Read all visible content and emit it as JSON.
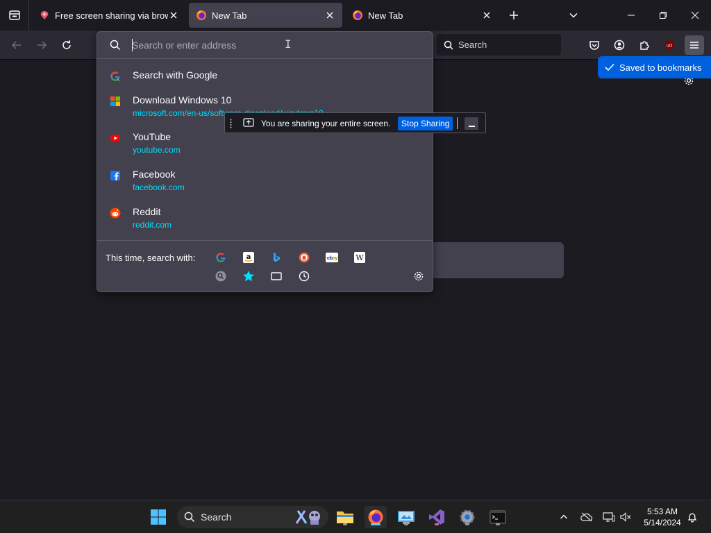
{
  "colors": {
    "toolbar": "#2b2a33",
    "panel": "#42414d",
    "accent": "#0061e0",
    "url": "#00ddff"
  },
  "tabs": [
    {
      "title": "Free screen sharing via browser",
      "icon": "screen-share-favicon",
      "active": false
    },
    {
      "title": "New Tab",
      "icon": "firefox-icon",
      "active": true
    },
    {
      "title": "New Tab",
      "icon": "firefox-icon",
      "active": false
    }
  ],
  "navbar": {
    "search_placeholder": "Search"
  },
  "urlbar": {
    "placeholder": "Search or enter address",
    "results": [
      {
        "title": "Search with Google",
        "url": "",
        "icon": "google-icon"
      },
      {
        "title": "Download Windows 10",
        "url": "microsoft.com/en-us/software-download/windows10",
        "icon": "microsoft-icon"
      },
      {
        "title": "YouTube",
        "url": "youtube.com",
        "icon": "youtube-icon"
      },
      {
        "title": "Facebook",
        "url": "facebook.com",
        "icon": "facebook-icon"
      },
      {
        "title": "Reddit",
        "url": "reddit.com",
        "icon": "reddit-icon"
      }
    ],
    "one_off_label": "This time, search with:",
    "engines": [
      "google-icon",
      "amazon-icon",
      "bing-icon",
      "duckduckgo-icon",
      "ebay-icon",
      "wikipedia-icon"
    ],
    "modes": [
      "search-tabs-icon",
      "bookmarks-star-icon",
      "tabs-icon",
      "history-clock-icon"
    ]
  },
  "sharing_bar": {
    "message": "You are sharing your entire screen.",
    "stop_label": "Stop Sharing"
  },
  "toast": {
    "message": "Saved to bookmarks"
  },
  "taskbar": {
    "search_label": "Search",
    "clock_time": "5:53 AM",
    "clock_date": "5/14/2024"
  }
}
